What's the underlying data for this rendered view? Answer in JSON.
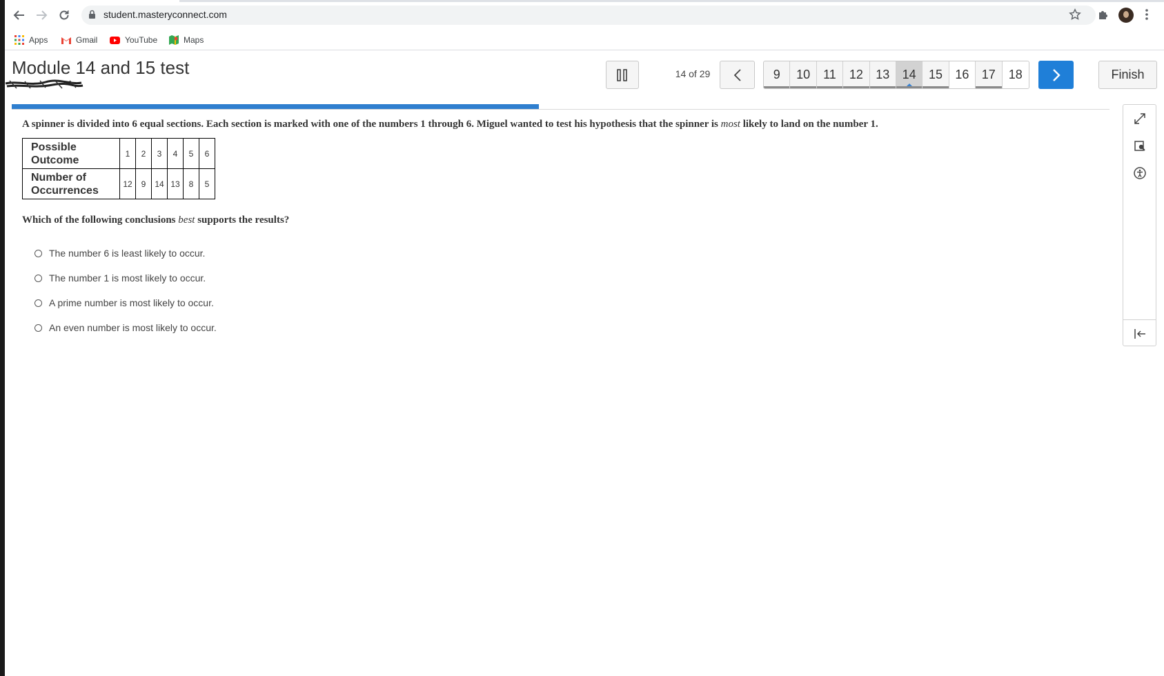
{
  "browser": {
    "url": "student.masteryconnect.com",
    "bookmarks": [
      {
        "label": "Apps",
        "icon": "apps-grid-icon"
      },
      {
        "label": "Gmail",
        "icon": "gmail-icon"
      },
      {
        "label": "YouTube",
        "icon": "youtube-icon"
      },
      {
        "label": "Maps",
        "icon": "maps-icon"
      }
    ]
  },
  "assessment": {
    "title": "Module 14 and 15 test",
    "counter": "14 of 29",
    "progress_fraction": 0.48,
    "question_numbers": [
      "9",
      "10",
      "11",
      "12",
      "13",
      "14",
      "15",
      "16",
      "17",
      "18"
    ],
    "current_question": "14",
    "finish_label": "Finish"
  },
  "question": {
    "stem_before": "A spinner is divided into 6 equal sections. Each section is marked with one of the numbers 1 through 6. Miguel wanted to test his hypothesis that the spinner is ",
    "stem_emphasis": "most",
    "stem_after": " likely to land on the number 1.",
    "table": {
      "row1_header_line1": "Possible",
      "row1_header_line2": "Outcome",
      "outcomes": [
        "1",
        "2",
        "3",
        "4",
        "5",
        "6"
      ],
      "row2_header_line1": "Number of",
      "row2_header_line2": "Occurrences",
      "occurrences": [
        "12",
        "9",
        "14",
        "13",
        "8",
        "5"
      ]
    },
    "prompt_before": "Which of the following conclusions ",
    "prompt_emphasis": "best",
    "prompt_after": " supports the results?",
    "choices": [
      "The number 6 is least likely to occur.",
      "The number 1 is most likely to occur.",
      "A prime number is most likely to occur.",
      "An even number is most likely to occur."
    ]
  },
  "colors": {
    "accent": "#1f7fd8",
    "progress": "#2f7fcf"
  }
}
